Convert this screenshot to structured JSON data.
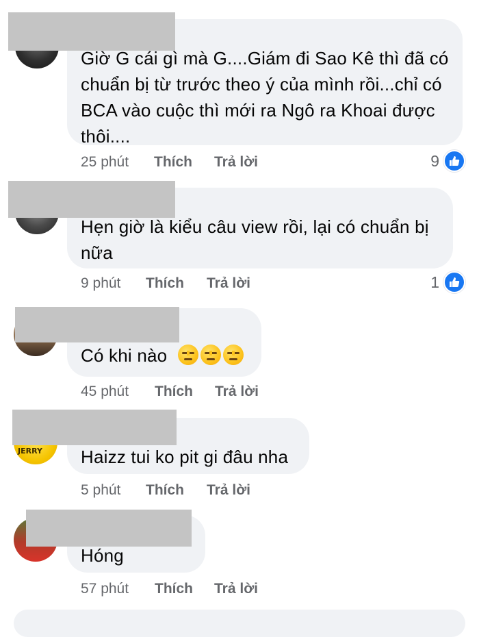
{
  "comments": [
    {
      "text": "Giờ G cái gì mà G....Giám đi Sao Kê thì đã có chuẩn bị từ trước theo ý của mình rồi...chỉ có BCA vào cuộc thì mới ra Ngô ra Khoai được thôi....",
      "time": "25 phút",
      "like": "Thích",
      "reply": "Trả lời",
      "reactions": "9"
    },
    {
      "text": "Hẹn giờ là kiểu câu view rồi, lại có chuẩn bị nữa",
      "time": "9 phút",
      "like": "Thích",
      "reply": "Trả lời",
      "reactions": "1"
    },
    {
      "text": "Có khi nào",
      "emoji": [
        "expressionless-face-emoji",
        "expressionless-face-emoji",
        "expressionless-face-emoji"
      ],
      "time": "45 phút",
      "like": "Thích",
      "reply": "Trả lời"
    },
    {
      "text": "Haizz tui ko pit gi đâu nha",
      "avatar_badge": "JERRY",
      "time": "5 phút",
      "like": "Thích",
      "reply": "Trả lời"
    },
    {
      "text": "Hóng",
      "time": "57 phút",
      "like": "Thích",
      "reply": "Trả lời"
    }
  ],
  "colors": {
    "bubble": "#f0f2f5",
    "meta_text": "#65676b",
    "like_blue": "#1877f2",
    "redaction": "#c4c4c4"
  }
}
